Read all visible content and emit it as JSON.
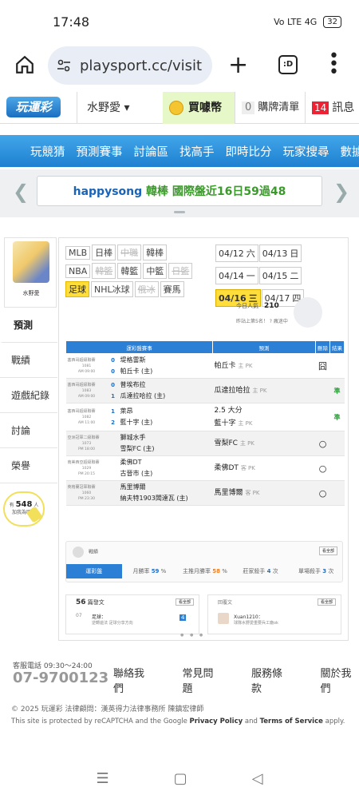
{
  "status": {
    "time": "17:48",
    "signal": "Vo LTE 4G",
    "battery": "32"
  },
  "browser": {
    "url": "playsport.cc/visit",
    "tabs_count": ":D"
  },
  "site": {
    "logo": "玩運彩",
    "user": "水野愛 ▾",
    "buy_coin": "買噱幣",
    "cart_count": "0",
    "cart_label": "購牌清單",
    "msg_count": "14",
    "msg_label": "訊息"
  },
  "nav": [
    "玩競猜",
    "預測賽事",
    "討論區",
    "找高手",
    "即時比分",
    "玩家搜尋",
    "數據"
  ],
  "ticker": {
    "user": "happysong",
    "text": "韓棒 國際盤近16日59過48"
  },
  "profile": {
    "name": "水野愛"
  },
  "sidebar": [
    "預測",
    "戰績",
    "遊戲紀錄",
    "討論",
    "榮譽"
  ],
  "bulb": {
    "prefix": "有",
    "count": "548",
    "suffix": "人",
    "line2": "加我為明燈"
  },
  "leagues": {
    "row1": [
      {
        "t": "MLB",
        "s": ""
      },
      {
        "t": "日棒",
        "s": ""
      },
      {
        "t": "中職",
        "s": "dim"
      },
      {
        "t": "韓棒",
        "s": ""
      }
    ],
    "row2": [
      {
        "t": "NBA",
        "s": ""
      },
      {
        "t": "韓籃",
        "s": "dim"
      },
      {
        "t": "韓籃",
        "s": ""
      },
      {
        "t": "中籃",
        "s": ""
      },
      {
        "t": "日籃",
        "s": "dim"
      }
    ],
    "row3": [
      {
        "t": "足球",
        "s": "sel"
      },
      {
        "t": "NHL冰球",
        "s": ""
      },
      {
        "t": "俄冰",
        "s": "dim"
      },
      {
        "t": "賽馬",
        "s": ""
      }
    ]
  },
  "dates": [
    {
      "d": "04/12",
      "w": "六",
      "s": ""
    },
    {
      "d": "04/13",
      "w": "日",
      "s": ""
    },
    {
      "d": "04/14",
      "w": "一",
      "s": ""
    },
    {
      "d": "04/15",
      "w": "二",
      "s": ""
    },
    {
      "d": "04/16",
      "w": "三",
      "s": "sel"
    },
    {
      "d": "04/17",
      "w": "四",
      "s": ""
    }
  ],
  "popularity": {
    "label": "今日人氣",
    "value": "210",
    "rank": "昨站上第5名！ ? 瘋迷中"
  },
  "table": {
    "headers": [
      "運彩盤賽事",
      "預測",
      "刪除",
      "結果"
    ],
    "rows": [
      {
        "league": "塞西哥超級聯賽",
        "id": "1081",
        "time": "AM 09:00",
        "s1": "0",
        "s2": "0",
        "t1": "堤格雷斯",
        "t2": "帕丘卡 (主)",
        "pk1": "帕丘卡",
        "pk1i": "主 PK",
        "pk2": "",
        "pk2i": "",
        "chk": "囧",
        "res": "",
        "alt": false
      },
      {
        "league": "塞西哥超級聯賽",
        "id": "1083",
        "time": "AM 09:00",
        "s1": "0",
        "s2": "1",
        "t1": "普埃布拉",
        "t2": "瓜達拉哈拉 (主)",
        "pk1": "瓜達拉哈拉",
        "pk1i": "主 PK",
        "pk2": "",
        "pk2i": "",
        "chk": "",
        "res": "準",
        "alt": true
      },
      {
        "league": "塞西哥超級聯賽",
        "id": "1082",
        "time": "AM 11:00",
        "s1": "1",
        "s2": "2",
        "t1": "萊昂",
        "t2": "藍十字 (主)",
        "pk1": "2.5 大分",
        "pk1i": "",
        "pk2": "藍十字",
        "pk2i": "主 PK",
        "chk": "",
        "res": "準",
        "alt": false
      },
      {
        "league": "亞洲冠軍二級聯賽",
        "id": "1073",
        "time": "PM 18:00",
        "s1": "",
        "s2": "",
        "t1": "獅城水手",
        "t2": "雪梨FC (主)",
        "pk1": "雪梨FC",
        "pk1i": "主 PK",
        "pk2": "",
        "pk2i": "",
        "chk": "○",
        "res": "",
        "alt": true
      },
      {
        "league": "南美西亞超級聯賽",
        "id": "1029",
        "time": "PM 20:15",
        "s1": "",
        "s2": "",
        "t1": "柔佛DT",
        "t2": "古晉市 (主)",
        "pk1": "柔佛DT",
        "pk1i": "客 PK",
        "pk2": "",
        "pk2i": "",
        "chk": "○",
        "res": "",
        "alt": false
      },
      {
        "league": "英格蘭冠軍聯賽",
        "id": "1060",
        "time": "PM 23:30",
        "s1": "",
        "s2": "",
        "t1": "馬里博爾",
        "t2": "納夫特1903闆達瓦 (主)",
        "pk1": "馬里博爾",
        "pk1i": "客 PK",
        "pk2": "",
        "pk2i": "",
        "chk": "○",
        "res": "",
        "alt": true
      }
    ]
  },
  "record": {
    "title": "戰績",
    "all": "看全部",
    "stats": [
      {
        "label": "運彩盤",
        "val": "",
        "unit": ""
      },
      {
        "label": "月勝率",
        "val": "59",
        "unit": "%"
      },
      {
        "label": "主推月勝率",
        "val": "58",
        "unit": "%"
      },
      {
        "label": "莊家殺手",
        "val": "4",
        "unit": "次"
      },
      {
        "label": "單場殺手",
        "val": "3",
        "unit": "次"
      }
    ]
  },
  "posts": {
    "count": "56",
    "label": "篇發文",
    "all": "看全部",
    "date": "07",
    "title": "足球：",
    "sub": "逆轉遊法 足球分享方向",
    "badge": "4",
    "replies_title": "回覆文",
    "reply_user": "Xuan1210：",
    "reply_text": "球隊水野愛重要兵工廠ok"
  },
  "footer": {
    "tel_label": "客服電話 09:30～24:00",
    "tel": "07-9700123",
    "links": [
      "聯絡我們",
      "常見問題",
      "服務條款",
      "關於我們"
    ],
    "copyright": "© 2025 玩運彩 法律顧問：漢英得力法律事務所 陳鎮宏律師",
    "recaptcha_pre": "This site is protected by reCAPTCHA and the Google ",
    "privacy": "Privacy Policy",
    "and": " and ",
    "terms": "Terms of Service",
    "apply": " apply."
  }
}
